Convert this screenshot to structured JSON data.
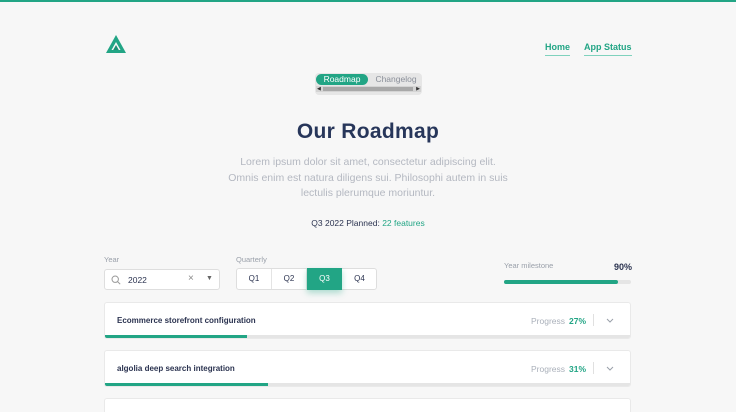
{
  "brand": {
    "accent": "#22a585",
    "logo_icon": "triangle-logo-icon"
  },
  "nav": {
    "home": "Home",
    "app_status": "App Status"
  },
  "segment": {
    "roadmap": "Roadmap",
    "changelog": "Changelog"
  },
  "hero": {
    "title": "Our Roadmap",
    "lead": "Lorem ipsum dolor sit amet, consectetur adipiscing elit. Omnis enim est natura diligens sui. Philosophi autem in suis lectulis plerumque moriuntur.",
    "planned_prefix": "Q3 2022 Planned:",
    "planned_count": "22 features"
  },
  "filters": {
    "year_label": "Year",
    "year_value": "2022",
    "quarterly_label": "Quarterly",
    "quarters": [
      "Q1",
      "Q2",
      "Q3",
      "Q4"
    ],
    "active_quarter": "Q3",
    "milestone_label": "Year milestone",
    "milestone_value": "90%",
    "milestone_progress": 0.9
  },
  "features": [
    {
      "name": "Ecommerce storefront configuration",
      "progress_label": "Progress",
      "progress_text": "27%",
      "progress": 0.27
    },
    {
      "name": "algolia deep search integration",
      "progress_label": "Progress",
      "progress_text": "31%",
      "progress": 0.31
    }
  ]
}
